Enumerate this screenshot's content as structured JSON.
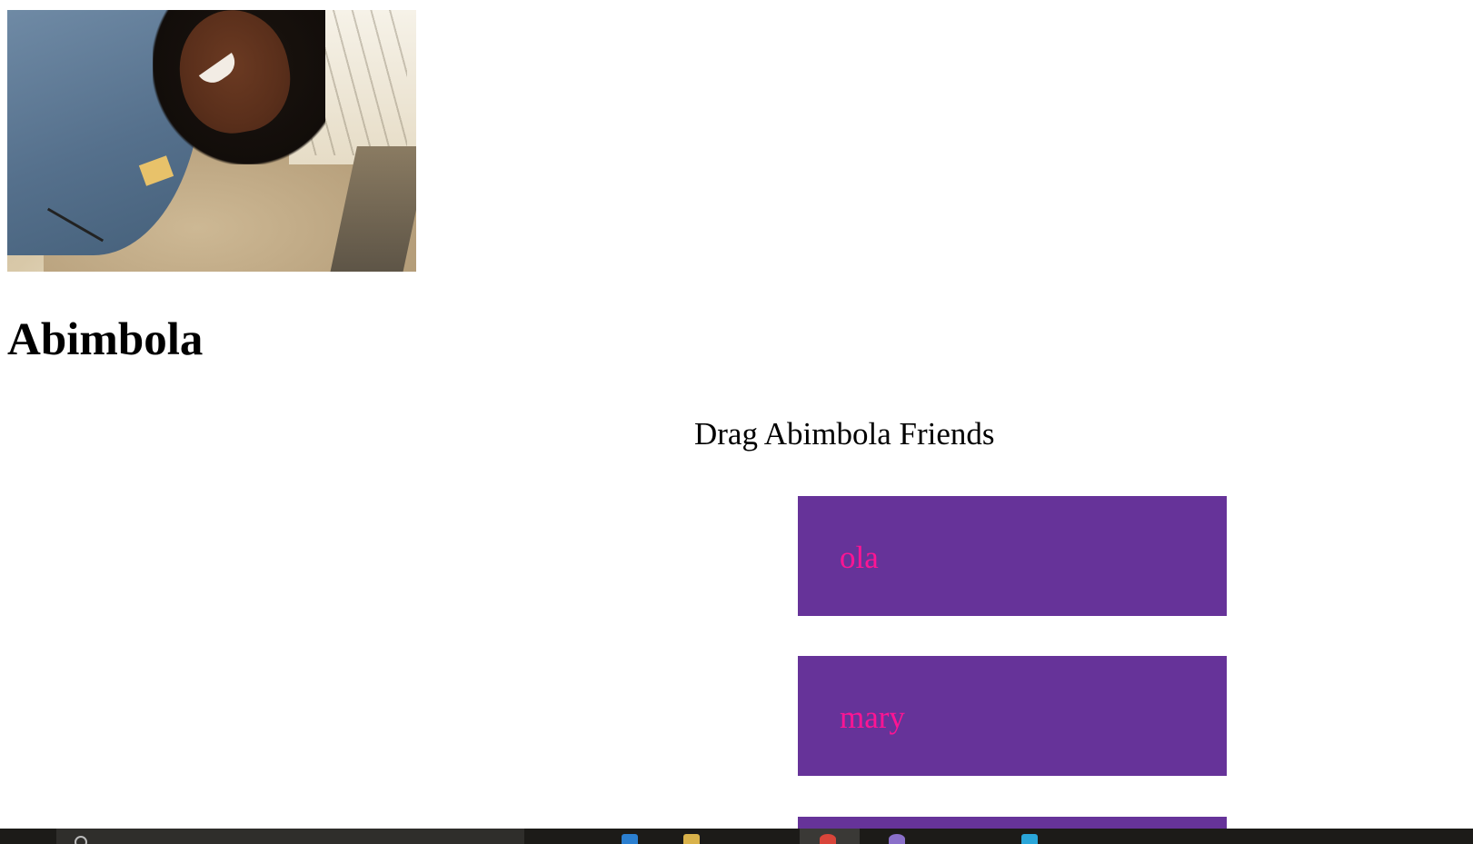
{
  "profile": {
    "photo_alt": "Abimbola",
    "name": "Abimbola"
  },
  "friends_section": {
    "heading": "Drag Abimbola Friends",
    "items": [
      {
        "label": "ola"
      },
      {
        "label": "mary"
      },
      {
        "label": ""
      }
    ]
  },
  "colors": {
    "card_background": "#663399",
    "card_text": "#ff1493"
  },
  "taskbar": {
    "icons": [
      "search-icon",
      "edge-icon",
      "file-explorer-icon",
      "chrome-icon",
      "photos-icon",
      "vscode-icon"
    ]
  }
}
